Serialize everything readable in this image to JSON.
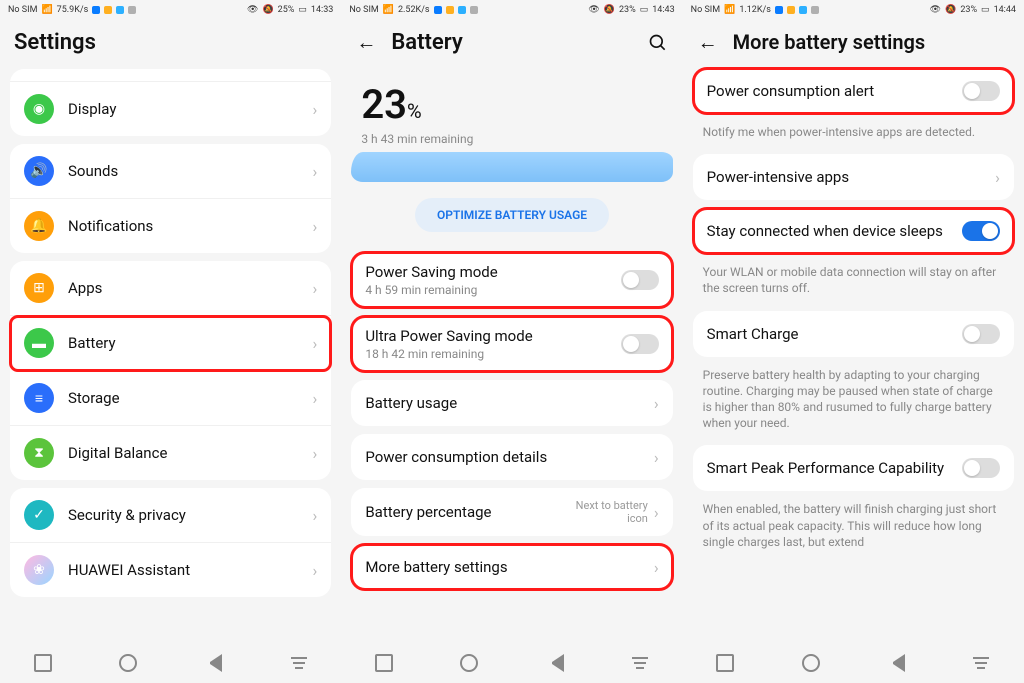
{
  "screen1": {
    "status": {
      "sim": "No SIM",
      "net": "75.9K/s",
      "batt": "25%",
      "time": "14:33"
    },
    "title": "Settings",
    "items": [
      {
        "label": "Display",
        "icon": "eye",
        "color": "ic-green"
      },
      {
        "label": "Sounds",
        "icon": "volume",
        "color": "ic-blue"
      },
      {
        "label": "Notifications",
        "icon": "bell",
        "color": "ic-orange"
      },
      {
        "label": "Apps",
        "icon": "grid",
        "color": "ic-orange"
      },
      {
        "label": "Battery",
        "icon": "battery",
        "color": "ic-green",
        "highlight": true
      },
      {
        "label": "Storage",
        "icon": "disk",
        "color": "ic-blue"
      },
      {
        "label": "Digital Balance",
        "icon": "hourglass",
        "color": "ic-lime"
      },
      {
        "label": "Security & privacy",
        "icon": "shield",
        "color": "ic-teal"
      },
      {
        "label": "HUAWEI Assistant",
        "icon": "swirl",
        "color": "ic-grad"
      }
    ]
  },
  "screen2": {
    "status": {
      "sim": "No SIM",
      "net": "2.52K/s",
      "batt": "23%",
      "time": "14:43"
    },
    "title": "Battery",
    "percent": "23",
    "percent_unit": "%",
    "remaining": "3 h 43 min remaining",
    "optimize": "OPTIMIZE BATTERY USAGE",
    "rows": [
      {
        "label": "Power Saving mode",
        "sub": "4 h 59 min remaining",
        "toggle": false,
        "highlight": true
      },
      {
        "label": "Ultra Power Saving mode",
        "sub": "18 h 42 min remaining",
        "toggle": false,
        "highlight": true
      },
      {
        "label": "Battery usage",
        "chevron": true
      },
      {
        "label": "Power consumption details",
        "chevron": true
      },
      {
        "label": "Battery percentage",
        "right": "Next to battery icon",
        "chevron": true
      },
      {
        "label": "More battery settings",
        "chevron": true,
        "highlight": true
      }
    ]
  },
  "screen3": {
    "status": {
      "sim": "No SIM",
      "net": "1.12K/s",
      "batt": "23%",
      "time": "14:44"
    },
    "title": "More battery settings",
    "rows": [
      {
        "label": "Power consumption alert",
        "toggle": false,
        "highlight": true,
        "desc": "Notify me when power-intensive apps are detected."
      },
      {
        "label": "Power-intensive apps",
        "chevron": true
      },
      {
        "label": "Stay connected when device sleeps",
        "toggle": true,
        "highlight": true,
        "desc": "Your WLAN or mobile data connection will stay on after the screen turns off."
      },
      {
        "label": "Smart Charge",
        "toggle": false,
        "desc": "Preserve battery health by adapting to your charging routine. Charging may be paused when state of charge is higher than 80% and rusumed to fully charge battery when your need."
      },
      {
        "label": "Smart Peak Performance Capability",
        "toggle": false,
        "desc": "When enabled, the battery will finish charging just short of its actual peak capacity. This will reduce how long single charges last, but extend"
      }
    ]
  }
}
